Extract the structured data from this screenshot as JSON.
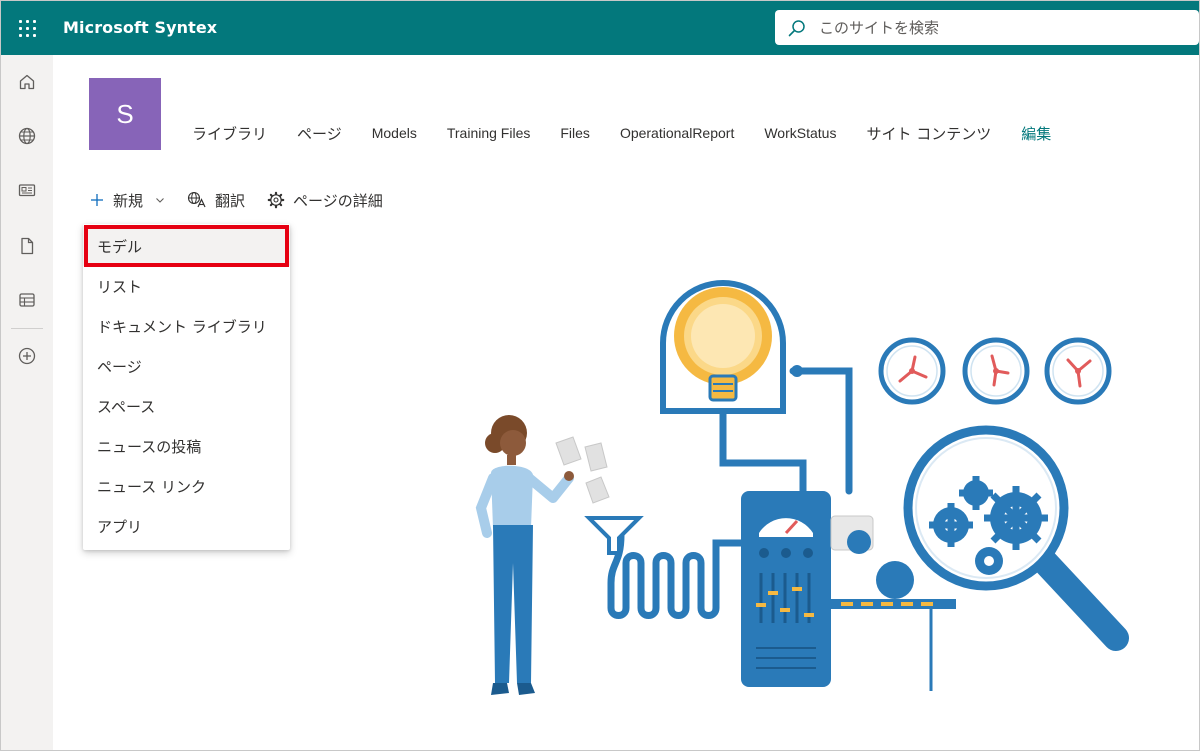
{
  "app": {
    "title": "Microsoft Syntex"
  },
  "search": {
    "placeholder": "このサイトを検索"
  },
  "rail": {
    "items": [
      {
        "name": "home"
      },
      {
        "name": "sites"
      },
      {
        "name": "news"
      },
      {
        "name": "files"
      },
      {
        "name": "lists"
      },
      {
        "name": "create"
      }
    ]
  },
  "site": {
    "logo_letter": "S",
    "logo_color": "#8764b8",
    "nav": [
      "ライブラリ",
      "ページ",
      "Models",
      "Training Files",
      "Files",
      "OperationalReport",
      "WorkStatus",
      "サイト コンテンツ"
    ],
    "edit_label": "編集"
  },
  "commandbar": {
    "new_label": "新規",
    "translate_label": "翻訳",
    "page_details_label": "ページの詳細"
  },
  "new_menu": {
    "items": [
      "モデル",
      "リスト",
      "ドキュメント ライブラリ",
      "ページ",
      "スペース",
      "ニュースの投稿",
      "ニュース リンク",
      "アプリ"
    ],
    "highlighted_index": 0
  },
  "colors": {
    "suite_bar": "#03787c",
    "rail": "#f3f2f1",
    "highlight": "#e60012",
    "illustration_blue": "#2a7ab8"
  }
}
